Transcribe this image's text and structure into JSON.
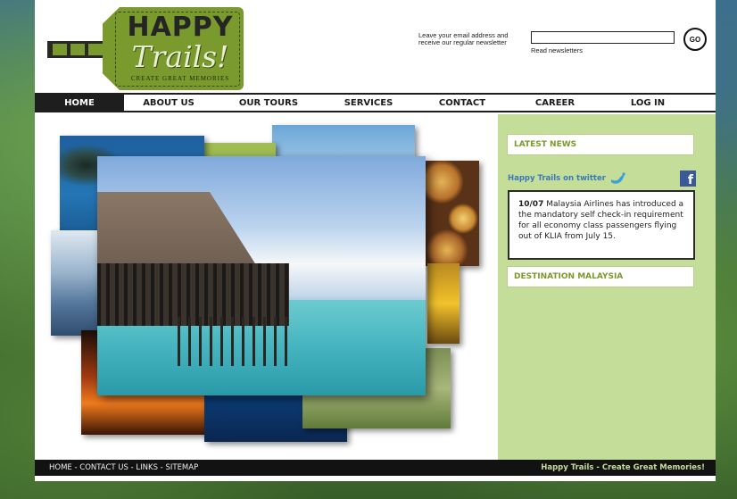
{
  "header": {
    "logo": {
      "word1": "HAPPY",
      "word2": "Trails!",
      "tagline": "CREATE GREAT MEMORIES"
    },
    "newsletter": {
      "prompt": "Leave your email address and receive our regular newsletter",
      "input_value": "",
      "read_link": "Read newsletters",
      "go_label": "GO"
    }
  },
  "nav": {
    "items": [
      {
        "label": "HOME",
        "active": true
      },
      {
        "label": "ABOUT US"
      },
      {
        "label": "OUR TOURS"
      },
      {
        "label": "SERVICES"
      },
      {
        "label": "CONTACT"
      },
      {
        "label": "CAREER"
      },
      {
        "label": "LOG IN"
      }
    ]
  },
  "sidebar": {
    "latest_news_title": "LATEST NEWS",
    "twitter_label": "Happy Trails on twitter",
    "facebook_letter": "f",
    "news": {
      "date": "10/07",
      "text": " Malaysia Airlines has introduced a the mandatory self check-in requirement for all economy class passengers flying out of KLIA from July 15."
    },
    "destination_title": "DESTINATION MALAYSIA"
  },
  "footer": {
    "links": [
      "HOME",
      "CONTACT US",
      "LINKS",
      "SITEMAP"
    ],
    "separator": " - ",
    "slogan": "Happy Trails - Create Great Memories!"
  },
  "colors": {
    "brand_green": "#7a9a2d",
    "sidebar_bg": "#c4de9a",
    "nav_dark": "#1e1e1e",
    "twitter_blue": "#3b78b8",
    "facebook_blue": "#3b5998"
  },
  "icons": [
    "twitter-bird-icon",
    "facebook-icon",
    "luggage-tag-icon"
  ]
}
